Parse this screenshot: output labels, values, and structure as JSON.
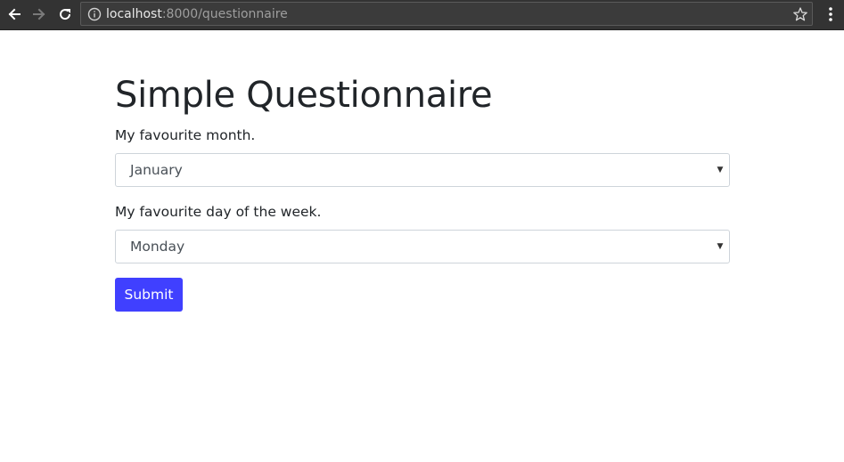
{
  "browser": {
    "url_host": "localhost",
    "url_rest": ":8000/questionnaire",
    "icons": {
      "back": "back-arrow-icon",
      "forward": "forward-arrow-icon",
      "reload": "reload-icon",
      "info": "info-icon",
      "bookmark": "star-icon",
      "menu": "kebab-menu-icon"
    }
  },
  "page": {
    "title": "Simple Questionnaire",
    "questions": [
      {
        "label": "My favourite month.",
        "selected": "January"
      },
      {
        "label": "My favourite day of the week.",
        "selected": "Monday"
      }
    ],
    "submit_label": "Submit"
  },
  "colors": {
    "chrome_bg": "#333333",
    "submit_bg": "#4040ff",
    "text": "#212529"
  }
}
